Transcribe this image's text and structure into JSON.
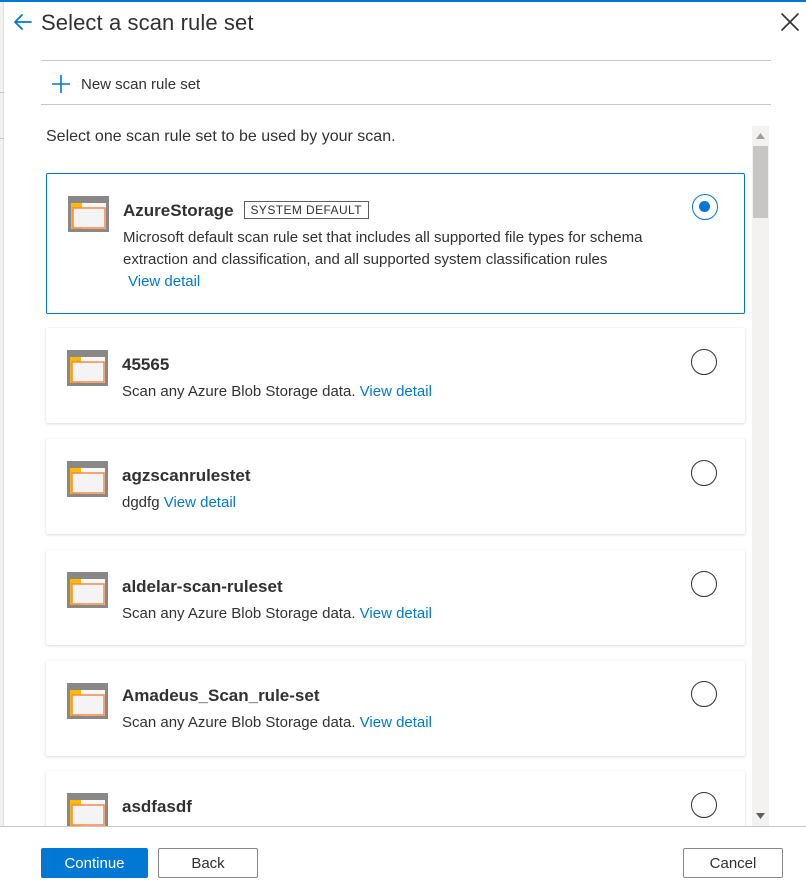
{
  "panel": {
    "title": "Select a scan rule set",
    "new_button_label": "New scan rule set",
    "instruction": "Select one scan rule set to be used by your scan."
  },
  "rule_sets": [
    {
      "name": "AzureStorage",
      "badge": "SYSTEM DEFAULT",
      "description": "Microsoft default scan rule set that includes all supported file types for schema extraction and classification, and all supported system classification rules",
      "link": "View detail",
      "selected": true
    },
    {
      "name": "45565",
      "description": "Scan any Azure Blob Storage data.",
      "link": "View detail",
      "selected": false
    },
    {
      "name": "agzscanrulestet",
      "description": "dgdfg",
      "link": "View detail",
      "selected": false
    },
    {
      "name": "aldelar-scan-ruleset",
      "description": "Scan any Azure Blob Storage data.",
      "link": "View detail",
      "selected": false
    },
    {
      "name": "Amadeus_Scan_rule-set",
      "description": "Scan any Azure Blob Storage data.",
      "link": "View detail",
      "selected": false
    },
    {
      "name": "asdfasdf",
      "selected": false
    }
  ],
  "footer": {
    "continue_label": "Continue",
    "back_label": "Back",
    "cancel_label": "Cancel"
  },
  "colors": {
    "accent": "#0078d4",
    "text": "#323130",
    "border": "#c8c6c4",
    "folder_light": "#ffb900",
    "folder_dark": "#f7894a",
    "folder_frame": "#8a8886"
  },
  "icons": {
    "back": "back-arrow-icon",
    "close": "close-icon",
    "add": "plus-icon",
    "rule_set": "folder-icon",
    "scroll_up": "scroll-up-icon",
    "scroll_down": "scroll-down-icon"
  }
}
